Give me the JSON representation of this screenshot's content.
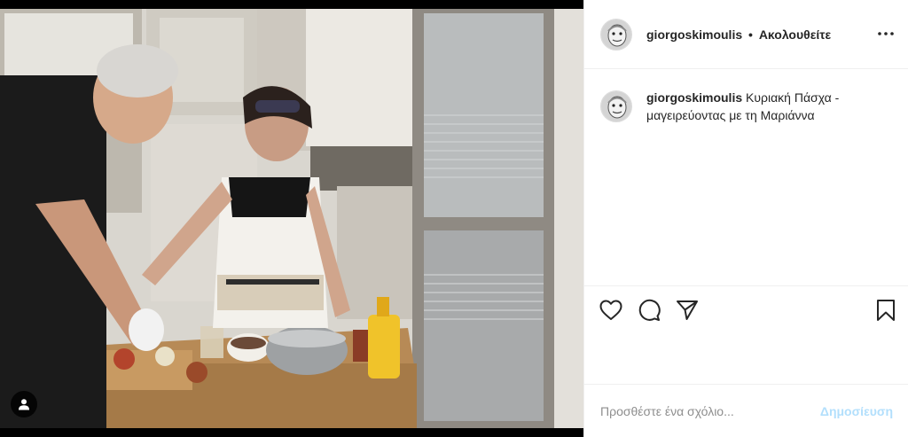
{
  "post": {
    "username": "giorgoskimoulis",
    "separator": "•",
    "follow_status": "Ακολουθείτε",
    "caption": "Κυριακή Πάσχα - μαγειρεύοντας με τη Μαριάννα"
  },
  "icons": {
    "more": "more-options-icon",
    "like": "heart-icon",
    "comment": "comment-bubble-icon",
    "share": "paper-plane-icon",
    "save": "bookmark-icon",
    "tag": "user-tag-icon"
  },
  "comment": {
    "placeholder": "Προσθέστε ένα σχόλιο...",
    "submit_label": "Δημοσίευση"
  },
  "colors": {
    "text": "#262626",
    "muted": "#8e8e8e",
    "divider": "#efefef",
    "submit_disabled": "#b2dffc"
  }
}
